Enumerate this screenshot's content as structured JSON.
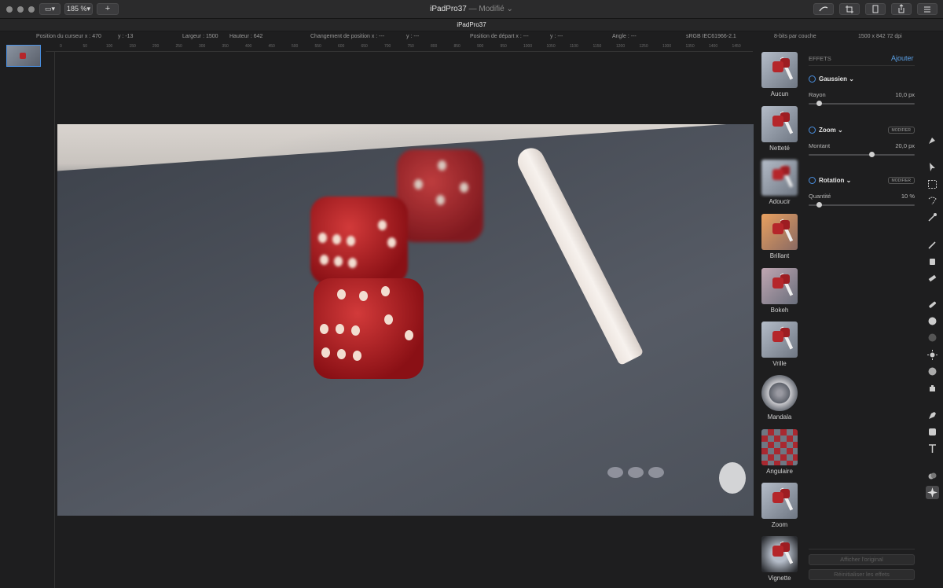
{
  "window": {
    "title": "iPadPro37",
    "subtitle": " — Modifié ",
    "zoom": "185 %",
    "add_label": "+",
    "tab_title": "iPadPro37"
  },
  "infobar": {
    "cursor_x": "Position du curseur x : 470",
    "cursor_y": "y : -13",
    "width": "Largeur : 1500",
    "height": "Hauteur : 642",
    "delta_x": "Changement de position x : ---",
    "delta_y": "y : ---",
    "start_x": "Position de départ x : ---",
    "start_y": "y : ---",
    "angle": "Angle : ---",
    "profile": "sRGB IEC61966-2.1",
    "depth": "8-bits par couche",
    "resolution": "1500 x 842 72 dpi"
  },
  "ruler": {
    "h_ticks": [
      "0",
      "50",
      "100",
      "150",
      "200",
      "250",
      "300",
      "350",
      "400",
      "450",
      "500",
      "550",
      "600",
      "650",
      "700",
      "750",
      "800",
      "850",
      "900",
      "950",
      "1000",
      "1050",
      "1100",
      "1150",
      "1200",
      "1250",
      "1300",
      "1350",
      "1400",
      "1450"
    ]
  },
  "effects_thumbs": [
    {
      "label": "Aucun"
    },
    {
      "label": "Netteté"
    },
    {
      "label": "Adoucir"
    },
    {
      "label": "Brillant"
    },
    {
      "label": "Bokeh"
    },
    {
      "label": "Vrille"
    },
    {
      "label": "Mandala"
    },
    {
      "label": "Angulaire"
    },
    {
      "label": "Zoom"
    },
    {
      "label": "Vignette"
    }
  ],
  "panel": {
    "header": "EFFETS",
    "add": "Ajouter",
    "effects": [
      {
        "name": "Gaussien",
        "modify": "",
        "param": "Rayon",
        "value": "10,0 px",
        "level": 0.08
      },
      {
        "name": "Zoom",
        "modify": "MODIFIER",
        "param": "Montant",
        "value": "20,0 px",
        "level": 0.6
      },
      {
        "name": "Rotation",
        "modify": "MODIFIER",
        "param": "Quantité",
        "value": "10 %",
        "level": 0.08
      }
    ],
    "show_original": "Afficher l'original",
    "reset": "Réinitialiser les effets"
  },
  "colors": {
    "accent": "#4a90e2",
    "die_red": "#b5262a"
  }
}
